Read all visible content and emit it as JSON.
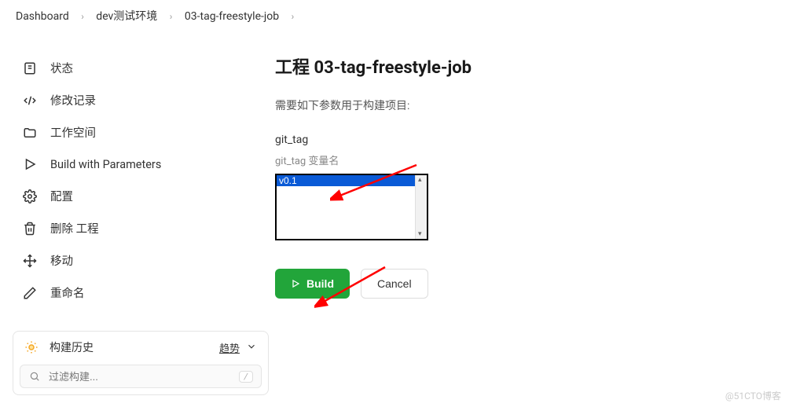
{
  "breadcrumb": {
    "items": [
      {
        "label": "Dashboard"
      },
      {
        "label": "dev测试环境"
      },
      {
        "label": "03-tag-freestyle-job"
      }
    ]
  },
  "sidebar": {
    "items": [
      {
        "label": "状态"
      },
      {
        "label": "修改记录"
      },
      {
        "label": "工作空间"
      },
      {
        "label": "Build with Parameters"
      },
      {
        "label": "配置"
      },
      {
        "label": "删除 工程"
      },
      {
        "label": "移动"
      },
      {
        "label": "重命名"
      }
    ]
  },
  "history": {
    "title": "构建历史",
    "trend_label": "趋势",
    "filter_placeholder": "过滤构建...",
    "kbd_hint": "/"
  },
  "main": {
    "title": "工程 03-tag-freestyle-job",
    "description": "需要如下参数用于构建项目:",
    "param": {
      "name": "git_tag",
      "help": "git_tag 变量名",
      "options": [
        "v0.1"
      ],
      "selected": "v0.1"
    },
    "build_label": "Build",
    "cancel_label": "Cancel"
  },
  "watermark": "@51CTO博客"
}
